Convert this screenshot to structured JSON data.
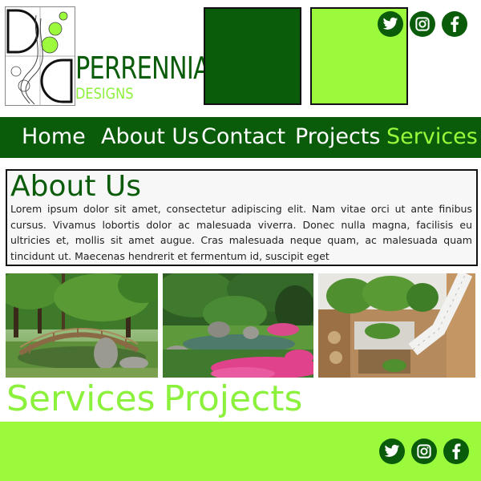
{
  "brand": {
    "name": "PERRENNIAL",
    "tagline": "DESIGNS"
  },
  "colors": {
    "dark_green": "#0a5c0a",
    "light_green": "#9cfa3c",
    "white": "#ffffff"
  },
  "social": {
    "icons": [
      "twitter-icon",
      "instagram-icon",
      "facebook-icon"
    ]
  },
  "nav": {
    "items": [
      {
        "label": "Home",
        "active": false
      },
      {
        "label": "About Us",
        "active": false
      },
      {
        "label": "Contact",
        "active": false
      },
      {
        "label": "Projects",
        "active": false
      },
      {
        "label": "Services",
        "active": true
      }
    ]
  },
  "about": {
    "title": "About Us",
    "body": "Lorem ipsum dolor sit amet, consectetur adipiscing elit. Nam vitae orci ut ante finibus cursus. Vivamus lobortis dolor ac malesuada viverra. Donec nulla magna, facilisis eu ultricies et, mollis sit amet augue. Cras malesuada neque quam, ac malesuada quam tincidunt ut. Maecenas hendrerit et fermentum id, suscipit eget"
  },
  "gallery": {
    "photos": [
      "garden-bridge-photo",
      "japanese-garden-pond-photo",
      "rooftop-garden-photo"
    ]
  },
  "sections": {
    "services_label": "Services",
    "projects_label": "Projects"
  }
}
